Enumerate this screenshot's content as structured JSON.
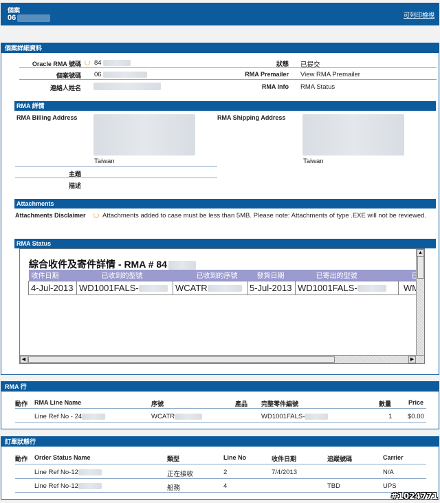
{
  "header": {
    "case_label": "個案",
    "case_number": "06",
    "print_link": "可列印檢視"
  },
  "details": {
    "title": "個案詳細資料",
    "oracle_rma_label": "Oracle RMA 號碼",
    "oracle_rma_value": "84",
    "case_no_label": "個案號碼",
    "case_no_value": "06",
    "contact_label": "連絡人姓名",
    "status_label": "狀態",
    "status_value": "已提交",
    "premailer_label": "RMA Premailer",
    "premailer_value": "View RMA Premailer",
    "rmainfo_label": "RMA Info",
    "rmainfo_value": "RMA Status"
  },
  "rma_details": {
    "title": "RMA 詳情",
    "billing_label": "RMA Billing Address",
    "billing_country": "Taiwan",
    "shipping_label": "RMA Shipping Address",
    "shipping_country": "Taiwan",
    "subject_label": "主題",
    "desc_label": "描述"
  },
  "attachments": {
    "title": "Attachments",
    "disclaimer_label": "Attachments Disclaimer",
    "disclaimer_text": "Attachments added to case must be less than 5MB. Please note: Attachments of type .EXE will not be reviewed."
  },
  "rma_status": {
    "title": "RMA Status",
    "frame_title": "綜合收件及寄件詳情 - RMA # 84",
    "headers": [
      "收件日期",
      "已收到的型號",
      "已收到的序號",
      "發貨日期",
      "已寄出的型號",
      "已"
    ],
    "row": [
      "4-Jul-2013",
      "WD1001FALS-",
      "WCATR",
      "5-Jul-2013",
      "WD1001FALS-",
      "WM"
    ]
  },
  "rma_lines": {
    "title": "RMA 行",
    "headers": {
      "action": "動作",
      "name": "RMA Line Name",
      "serial": "序號",
      "product": "產品",
      "part": "完整零件編號",
      "qty": "數量",
      "price": "Price"
    },
    "rows": [
      {
        "name": "Line Ref No - 24",
        "serial": "WCATR",
        "part": "WD1001FALS-",
        "qty": "1",
        "price": "$0.00"
      }
    ]
  },
  "order_status": {
    "title": "訂單狀態行",
    "headers": {
      "action": "動作",
      "name": "Order Status Name",
      "type": "類型",
      "line": "Line No",
      "date": "收件日期",
      "tracking": "追蹤號碼",
      "carrier": "Carrier"
    },
    "rows": [
      {
        "name": "Line Ref No-12",
        "type": "正在接收",
        "line": "2",
        "date": "7/4/2013",
        "tracking": "",
        "carrier": "N/A"
      },
      {
        "name": "Line Ref No-12",
        "type": "船務",
        "line": "4",
        "date": "",
        "tracking": "TBD",
        "carrier": "UPS"
      }
    ]
  },
  "watermark": "#1024771"
}
